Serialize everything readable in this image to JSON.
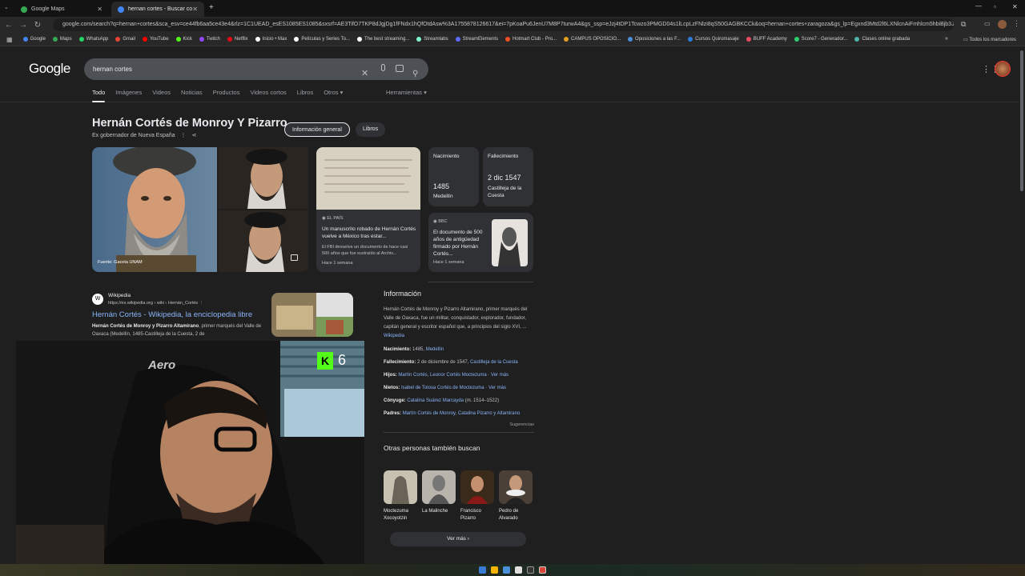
{
  "browser": {
    "tabs": [
      {
        "label": "Google Maps",
        "favicon_color": "#34a853"
      },
      {
        "label": "hernan cortes - Buscar con Go...",
        "favicon_color": "#4285f4"
      }
    ],
    "new_tab": "+",
    "url": "google.com/search?q=hernan+cortes&sca_esv=ce44fb6aa5ce43e4&rlz=1C1UEAD_esES1085ES1085&sxsrf=AE3TifO7TKP8dJgjDg1fFNdx1hQfOtdAsw%3A1755878126617&ei=7pKoaPu6JenU7M8P7turwA4&gs_ssp=eJzj4tDP1Tcwzo3PMGD04s1lLcpLzFNlzi8qS50GAGBKCCk&oq=hernan+cortes+zaragoza&gs_lp=Egxnd3Mtd2l6LXNlcnAiFmhlcm5hbiBjb3J0",
    "bookmarks": [
      {
        "label": "Google",
        "color": "#4285f4"
      },
      {
        "label": "Maps",
        "color": "#34a853"
      },
      {
        "label": "WhatsApp",
        "color": "#25d366"
      },
      {
        "label": "Gmail",
        "color": "#ea4335"
      },
      {
        "label": "YouTube",
        "color": "#ff0000"
      },
      {
        "label": "Kick",
        "color": "#53fc18"
      },
      {
        "label": "Twitch",
        "color": "#9146ff"
      },
      {
        "label": "Netflix",
        "color": "#e50914"
      },
      {
        "label": "Inicio • Max",
        "color": "#ffffff"
      },
      {
        "label": "Películas y Series To...",
        "color": "#ffffff"
      },
      {
        "label": "The best streaming...",
        "color": "#ffffff"
      },
      {
        "label": "Streamlabs",
        "color": "#80f5d2"
      },
      {
        "label": "StreamElements",
        "color": "#5f6bff"
      },
      {
        "label": "Hotmart Club - Pro...",
        "color": "#f04e23"
      },
      {
        "label": "CAMPUS OPOSICIO...",
        "color": "#e0a020"
      },
      {
        "label": "Oposiciones a las F...",
        "color": "#4a90d9"
      },
      {
        "label": "Cursos Quiromasaje",
        "color": "#2b7bd9"
      },
      {
        "label": "BUFF Academy",
        "color": "#e84a5f"
      },
      {
        "label": "Score7 - Generador...",
        "color": "#2ecc71"
      },
      {
        "label": "Clases online grabada",
        "color": "#4db6ac"
      }
    ],
    "bookmarks_more": "»",
    "all_bookmarks": "Todos los marcadores"
  },
  "google": {
    "logo": "Google",
    "query": "hernan cortes",
    "tabs": [
      "Todo",
      "Imágenes",
      "Videos",
      "Noticias",
      "Productos",
      "Videos cortos",
      "Libros",
      "Otros ▾"
    ],
    "tools": "Herramientas ▾"
  },
  "knowledge_panel": {
    "title": "Hernán Cortés de Monroy Y Pizarro",
    "subtitle": "Ex gobernador de Nueva España",
    "chips": [
      "Información general",
      "Libros"
    ],
    "image_source": "Fuente: Gaceta UNAM",
    "birth": {
      "label": "Nacimiento",
      "value": "1485",
      "place": "Medellín"
    },
    "death": {
      "label": "Fallecimiento",
      "value": "2 dic 1547",
      "place": "Castilleja de la Cuesta"
    },
    "news1": {
      "source": "EL PAÍS",
      "title": "Un manuscrito robado de Hernán Cortés vuelve a México tras estar...",
      "snippet": "El FBI devuelve un documento de hace casi 500 años que fue sustraído al Archiv...",
      "time": "Hace 1 semana"
    },
    "news2": {
      "source": "BBC",
      "title": "El documento de 500 años de antigüedad firmado por Hernán Cortés...",
      "time": "Hace 1 semana"
    }
  },
  "wiki_result": {
    "site": "Wikipedia",
    "url": "https://es.wikipedia.org › wiki › Hernán_Cortés",
    "title": "Hernán Cortés - Wikipedia, la enciclopedia libre",
    "snippet_bold": "Hernán Cortés de Monroy y Pizarro Altamirano",
    "snippet": ", primer marqués del Valle de Oaxaca (Medellín, 1485-Castilleja de la Cuesta, 2 de"
  },
  "info": {
    "heading": "Información",
    "description": "Hernán Cortés de Monroy y Pizarro Altamirano, primer marqués del Valle de Oaxaca, fue un militar, conquistador, explorador, fundador, capitán general y escritor español que, a principios del siglo XVI, ...",
    "description_link": "Wikipedia",
    "facts": [
      {
        "key": "Nacimiento:",
        "text": "1485, ",
        "link": "Medellín"
      },
      {
        "key": "Fallecimiento:",
        "text": "2 de diciembre de 1547, ",
        "link": "Castilleja de la Cuesta"
      },
      {
        "key": "Hijos:",
        "text": "",
        "link": "Martín Cortés, Leonor Cortés Moctezuma · Ver más"
      },
      {
        "key": "Nietos:",
        "text": "",
        "link": "Isabel de Tolosa Cortés de Moctezuma · Ver más"
      },
      {
        "key": "Cónyuge:",
        "text": "",
        "link": "Catalina Suárez Marcayda",
        "after": " (m. 1514–1522)"
      },
      {
        "key": "Padres:",
        "text": "",
        "link": "Martín Cortés de Monroy, Catalina Pizarro y Altamirano"
      }
    ],
    "feedback": "Sugerencias",
    "others_heading": "Otras personas también buscan",
    "others": [
      "Moctezuma Xocoyotzin",
      "La Malinche",
      "Francisco Pizarro",
      "Pedro de Alvarado"
    ],
    "see_more": "Ver más ›"
  },
  "webcam": {
    "logo_text": "Aero",
    "kick_badge": "6"
  }
}
